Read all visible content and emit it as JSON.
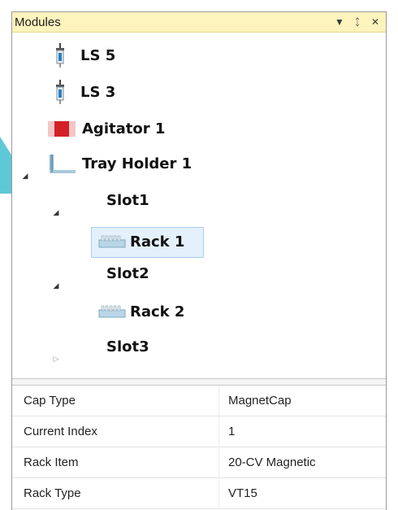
{
  "panel": {
    "title": "Modules",
    "dropdown_icon": "dropdown-arrow-icon",
    "pin_icon": "pin-icon",
    "close_icon": "close-icon",
    "dropdown_glyph": "▼",
    "pin_glyph": "ᛨ",
    "close_glyph": "✕"
  },
  "tree": {
    "nodes": [
      {
        "label": "LS 5",
        "icon": "syringe-icon"
      },
      {
        "label": "LS 3",
        "icon": "syringe-icon"
      },
      {
        "label": "Agitator 1",
        "icon": "agitator-icon"
      },
      {
        "label": "Tray Holder 1",
        "icon": "tray-holder-icon",
        "expanded": true
      },
      {
        "label": "Slot1",
        "expanded": true
      },
      {
        "label": "Rack 1",
        "icon": "rack-icon",
        "selected": true
      },
      {
        "label": "Slot2",
        "expanded": true
      },
      {
        "label": "Rack 2",
        "icon": "rack-icon"
      },
      {
        "label": "Slot3",
        "expanded": false
      }
    ]
  },
  "properties": {
    "rows": [
      {
        "key": "Cap Type",
        "value": "MagnetCap"
      },
      {
        "key": "Current Index",
        "value": "1"
      },
      {
        "key": "Rack Item",
        "value": "20-CV Magnetic"
      },
      {
        "key": "Rack Type",
        "value": "VT15"
      }
    ]
  },
  "colors": {
    "titlebar_bg": "#fdf3bc",
    "selection_bg": "#e4f0fb",
    "accent_cyan": "#5fc8d6",
    "agitator_red": "#d32027"
  }
}
